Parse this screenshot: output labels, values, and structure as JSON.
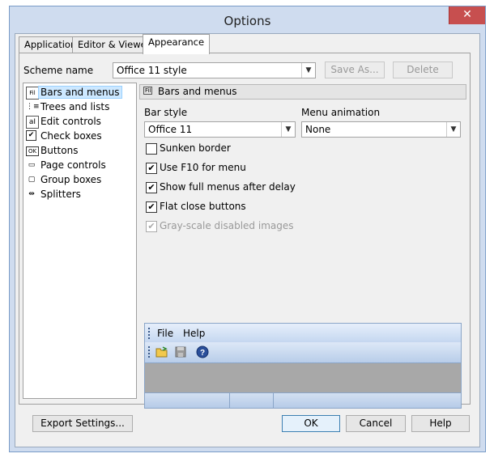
{
  "window": {
    "title": "Options",
    "close_glyph": "✕"
  },
  "tabs": [
    {
      "label": "Application"
    },
    {
      "label": "Editor & Viewers"
    },
    {
      "label": "Appearance"
    }
  ],
  "scheme": {
    "label": "Scheme name",
    "value": "Office 11 style",
    "save_as_label": "Save As...",
    "delete_label": "Delete"
  },
  "tree": {
    "items": [
      {
        "label": "Bars and menus",
        "icon": "bars-menus-icon",
        "glyph": "Fil"
      },
      {
        "label": "Trees and lists",
        "icon": "tree-list-icon",
        "glyph": "⋮≡"
      },
      {
        "label": "Edit controls",
        "icon": "edit-control-icon",
        "glyph": "aI"
      },
      {
        "label": "Check boxes",
        "icon": "check-box-icon",
        "glyph": "✔"
      },
      {
        "label": "Buttons",
        "icon": "button-icon",
        "glyph": "OK"
      },
      {
        "label": "Page controls",
        "icon": "page-control-icon",
        "glyph": "▭"
      },
      {
        "label": "Group boxes",
        "icon": "group-box-icon",
        "glyph": "▢"
      },
      {
        "label": "Splitters",
        "icon": "splitter-icon",
        "glyph": "⇹"
      }
    ]
  },
  "panel": {
    "header": "Bars and menus",
    "header_glyph": "Fil",
    "bar_style_label": "Bar style",
    "bar_style_value": "Office 11",
    "menu_animation_label": "Menu animation",
    "menu_animation_value": "None",
    "checkboxes": [
      {
        "label": "Sunken border",
        "mark": ""
      },
      {
        "label": "Use F10 for menu",
        "mark": "✔"
      },
      {
        "label": "Show full menus after delay",
        "mark": "✔"
      },
      {
        "label": "Flat close buttons",
        "mark": "✔"
      },
      {
        "label": "Gray-scale disabled images",
        "mark": "✔"
      }
    ],
    "preview": {
      "menu_file": "File",
      "menu_help": "Help",
      "toolbar_icons": [
        "open-folder-icon",
        "save-disk-icon",
        "help-icon"
      ]
    }
  },
  "buttons": {
    "export": "Export Settings...",
    "ok": "OK",
    "cancel": "Cancel",
    "help": "Help"
  },
  "dropdown_glyph": "▼",
  "colors": {
    "title_bg": "#cfdcef",
    "close_bg": "#c74f4f",
    "accent": "#3c7fb1"
  }
}
